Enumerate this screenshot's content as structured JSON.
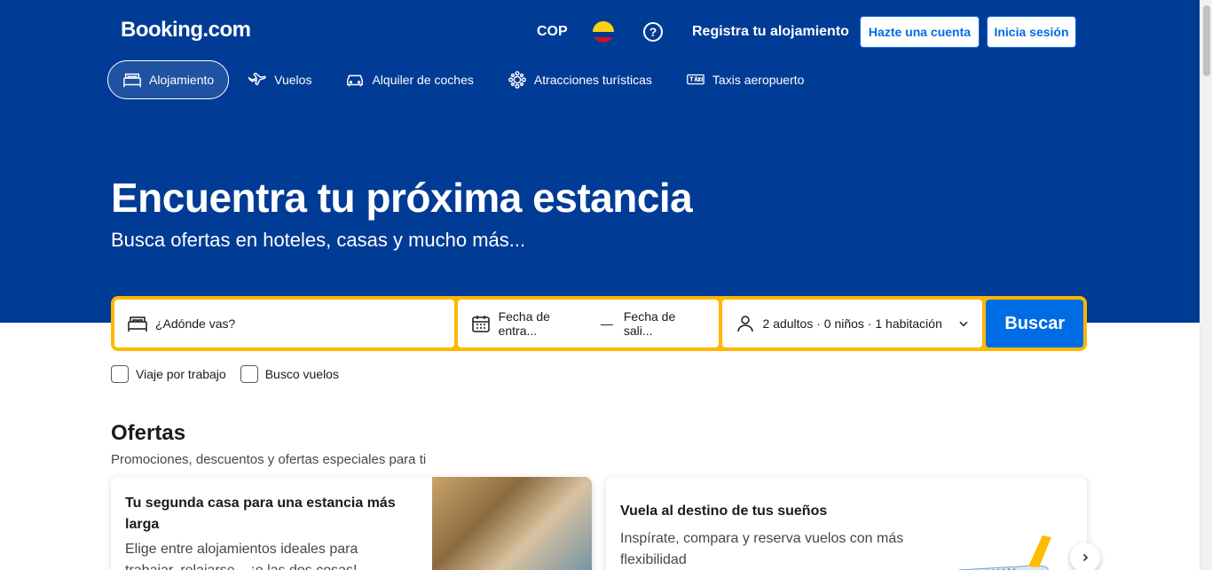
{
  "header": {
    "logo": "Booking.com",
    "currency": "COP",
    "help_symbol": "?",
    "register_property": "Registra tu alojamiento",
    "create_account": "Hazte una cuenta",
    "sign_in": "Inicia sesión"
  },
  "nav": {
    "items": [
      {
        "label": "Alojamiento",
        "icon": "bed-icon",
        "active": true
      },
      {
        "label": "Vuelos",
        "icon": "plane-icon",
        "active": false
      },
      {
        "label": "Alquiler de coches",
        "icon": "car-icon",
        "active": false
      },
      {
        "label": "Atracciones turísticas",
        "icon": "attractions-icon",
        "active": false
      },
      {
        "label": "Taxis aeropuerto",
        "icon": "taxi-icon",
        "active": false
      }
    ]
  },
  "hero": {
    "title": "Encuentra tu próxima estancia",
    "subtitle": "Busca ofertas en hoteles, casas y mucho más..."
  },
  "search": {
    "destination_placeholder": "¿Adónde vas?",
    "checkin": "Fecha de entra...",
    "separator": "—",
    "checkout": "Fecha de sali...",
    "guests": "2 adultos · 0 niños · 1 habitación",
    "button": "Buscar"
  },
  "options": {
    "work_trip": "Viaje por trabajo",
    "flights": "Busco vuelos"
  },
  "offers": {
    "title": "Ofertas",
    "subtitle": "Promociones, descuentos y ofertas especiales para ti",
    "cards": [
      {
        "title": "Tu segunda casa para una estancia más larga",
        "text": "Elige entre alojamientos ideales para trabajar, relajarse... ¡o las dos cosas!"
      },
      {
        "title": "Vuela al destino de tus sueños",
        "text": "Inspírate, compara y reserva vuelos con más flexibilidad"
      }
    ]
  },
  "colors": {
    "brand_blue": "#003b95",
    "accent_blue": "#006ce4",
    "search_border": "#ffb700"
  }
}
